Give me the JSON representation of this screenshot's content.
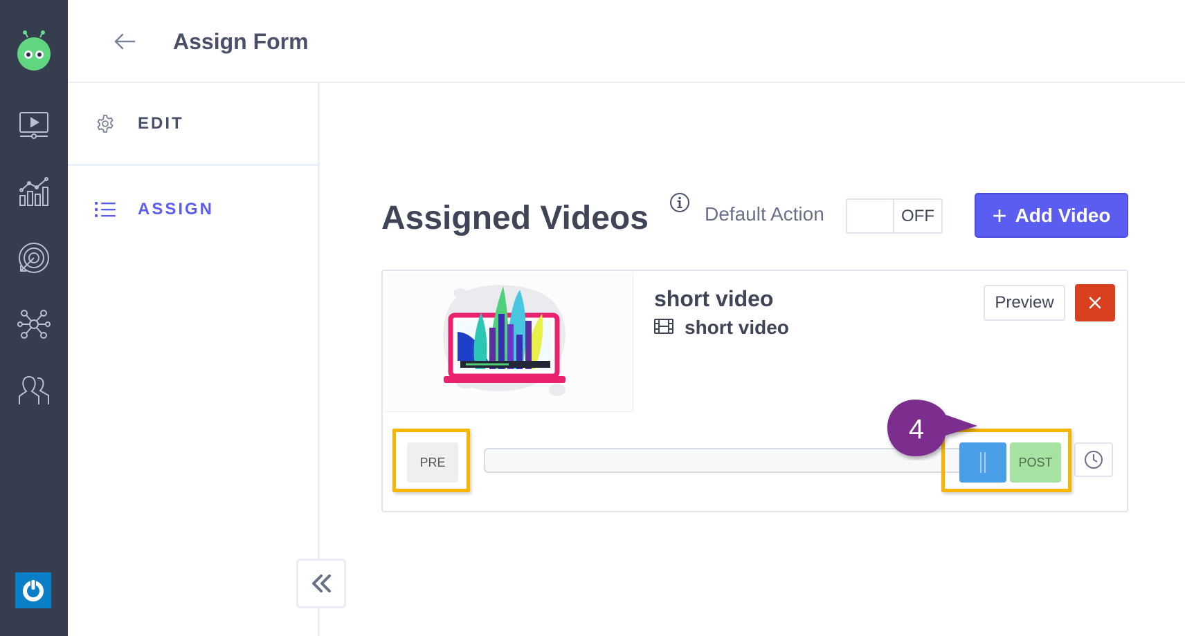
{
  "header": {
    "title": "Assign Form",
    "back_icon": "arrow-left-icon"
  },
  "subnav": {
    "items": [
      {
        "label": "EDIT",
        "icon": "gear-icon",
        "active": false
      },
      {
        "label": "ASSIGN",
        "icon": "list-icon",
        "active": true
      }
    ]
  },
  "main": {
    "title": "Assigned Videos",
    "default_action": {
      "label": "Default Action",
      "state": "OFF"
    },
    "add_button": {
      "label": "Add Video",
      "plus": "+"
    }
  },
  "video": {
    "title": "short video",
    "subtitle": "short video",
    "preview_label": "Preview",
    "remove_label": "×",
    "pre_label": "PRE",
    "post_label": "POST"
  },
  "annotation": {
    "step": "4"
  },
  "colors": {
    "nav_bg": "#363d4e",
    "accent": "#5b5cf0",
    "danger": "#d9401f",
    "handle": "#4a9ee8",
    "post": "#a6e3a3",
    "highlight": "#f7b500",
    "callout": "#7b2d8e"
  }
}
